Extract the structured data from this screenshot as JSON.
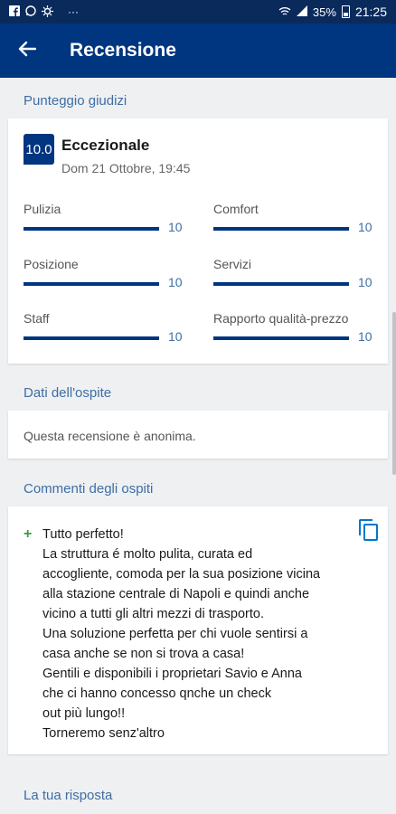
{
  "status_bar": {
    "battery": "35%",
    "time": "21:25"
  },
  "appbar": {
    "title": "Recensione"
  },
  "sections": {
    "scores": "Punteggio giudizi",
    "guest": "Dati dell'ospite",
    "comments": "Commenti degli ospiti",
    "reply": "La tua risposta"
  },
  "rating": {
    "score": "10.0",
    "label": "Eccezionale",
    "date": "Dom 21 Ottobre, 19:45"
  },
  "categories": [
    {
      "name": "Pulizia",
      "value": "10",
      "fraction": 1.0
    },
    {
      "name": "Comfort",
      "value": "10",
      "fraction": 1.0
    },
    {
      "name": "Posizione",
      "value": "10",
      "fraction": 1.0
    },
    {
      "name": "Servizi",
      "value": "10",
      "fraction": 1.0
    },
    {
      "name": "Staff",
      "value": "10",
      "fraction": 1.0
    },
    {
      "name": "Rapporto qualità-prezzo",
      "value": "10",
      "fraction": 1.0
    }
  ],
  "guest": {
    "text": "Questa recensione è anonima."
  },
  "comment": {
    "marker": "+",
    "lines": [
      "Tutto perfetto!",
      "La struttura é molto pulita, curata ed",
      "accogliente, comoda per la sua posizione vicina",
      "alla stazione centrale di Napoli e quindi anche",
      "vicino a tutti gli altri mezzi di trasporto.",
      "Una soluzione perfetta per chi vuole sentirsi a",
      "casa anche se non si trova a casa!",
      "Gentili e disponibili i proprietari Savio e Anna",
      "che ci hanno concesso qnche un check",
      "out più lungo!!",
      "Torneremo senz'altro"
    ]
  },
  "colors": {
    "primary": "#003580",
    "accent": "#3f6ea4",
    "positive": "#3a9b3a"
  },
  "icons": [
    "facebook-icon",
    "whatsapp-icon",
    "settings-icon",
    "more-icon",
    "wifi-icon",
    "signal-icon",
    "battery-icon",
    "back-arrow-icon",
    "copy-icon"
  ]
}
